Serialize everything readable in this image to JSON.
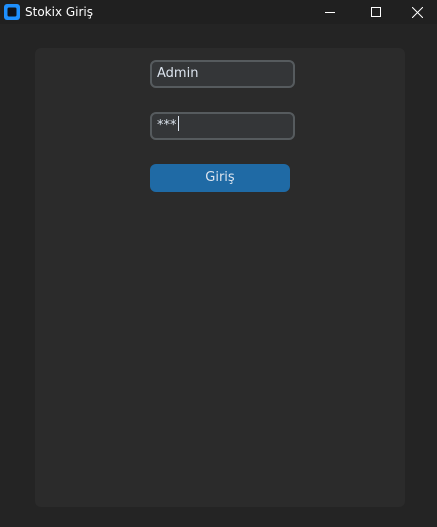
{
  "window": {
    "title": "Stokix Giriş",
    "icon": "app-logo-icon",
    "controls": [
      "minimize-icon",
      "maximize-icon",
      "close-icon"
    ]
  },
  "form": {
    "username_value": "Admin",
    "password_value": "***",
    "login_label": "Giriş"
  },
  "colors": {
    "background": "#242424",
    "frame": "#2b2b2b",
    "entry_bg": "#343638",
    "entry_border": "#565b5e",
    "button": "#1f6aa5",
    "text": "#dce4ee",
    "app_icon": "#1e90ff"
  }
}
